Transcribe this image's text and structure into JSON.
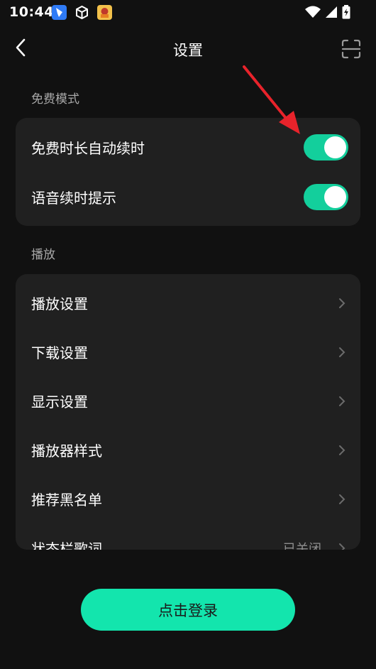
{
  "status_bar": {
    "time": "10:44",
    "icons": [
      "lark-app-icon",
      "cube-app-icon",
      "game-app-icon",
      "wifi-icon",
      "signal-icon",
      "battery-charging-icon"
    ]
  },
  "header": {
    "title": "设置",
    "back_icon": "chevron-left-icon",
    "scan_icon": "scan-icon"
  },
  "free_mode": {
    "section_label": "免费模式",
    "items": [
      {
        "label": "免费时长自动续时",
        "toggle_on": true
      },
      {
        "label": "语音续时提示",
        "toggle_on": true
      }
    ]
  },
  "playback": {
    "section_label": "播放",
    "items": [
      {
        "label": "播放设置",
        "value": ""
      },
      {
        "label": "下载设置",
        "value": ""
      },
      {
        "label": "显示设置",
        "value": ""
      },
      {
        "label": "播放器样式",
        "value": ""
      },
      {
        "label": "推荐黑名单",
        "value": ""
      },
      {
        "label": "状态栏歌词",
        "value": "已关闭"
      }
    ]
  },
  "login": {
    "label": "点击登录"
  },
  "colors": {
    "background": "#111111",
    "card": "#202020",
    "accent_toggle": "#13cf9c",
    "accent_button": "#13e5ad",
    "annotation_arrow": "#e8232b"
  }
}
